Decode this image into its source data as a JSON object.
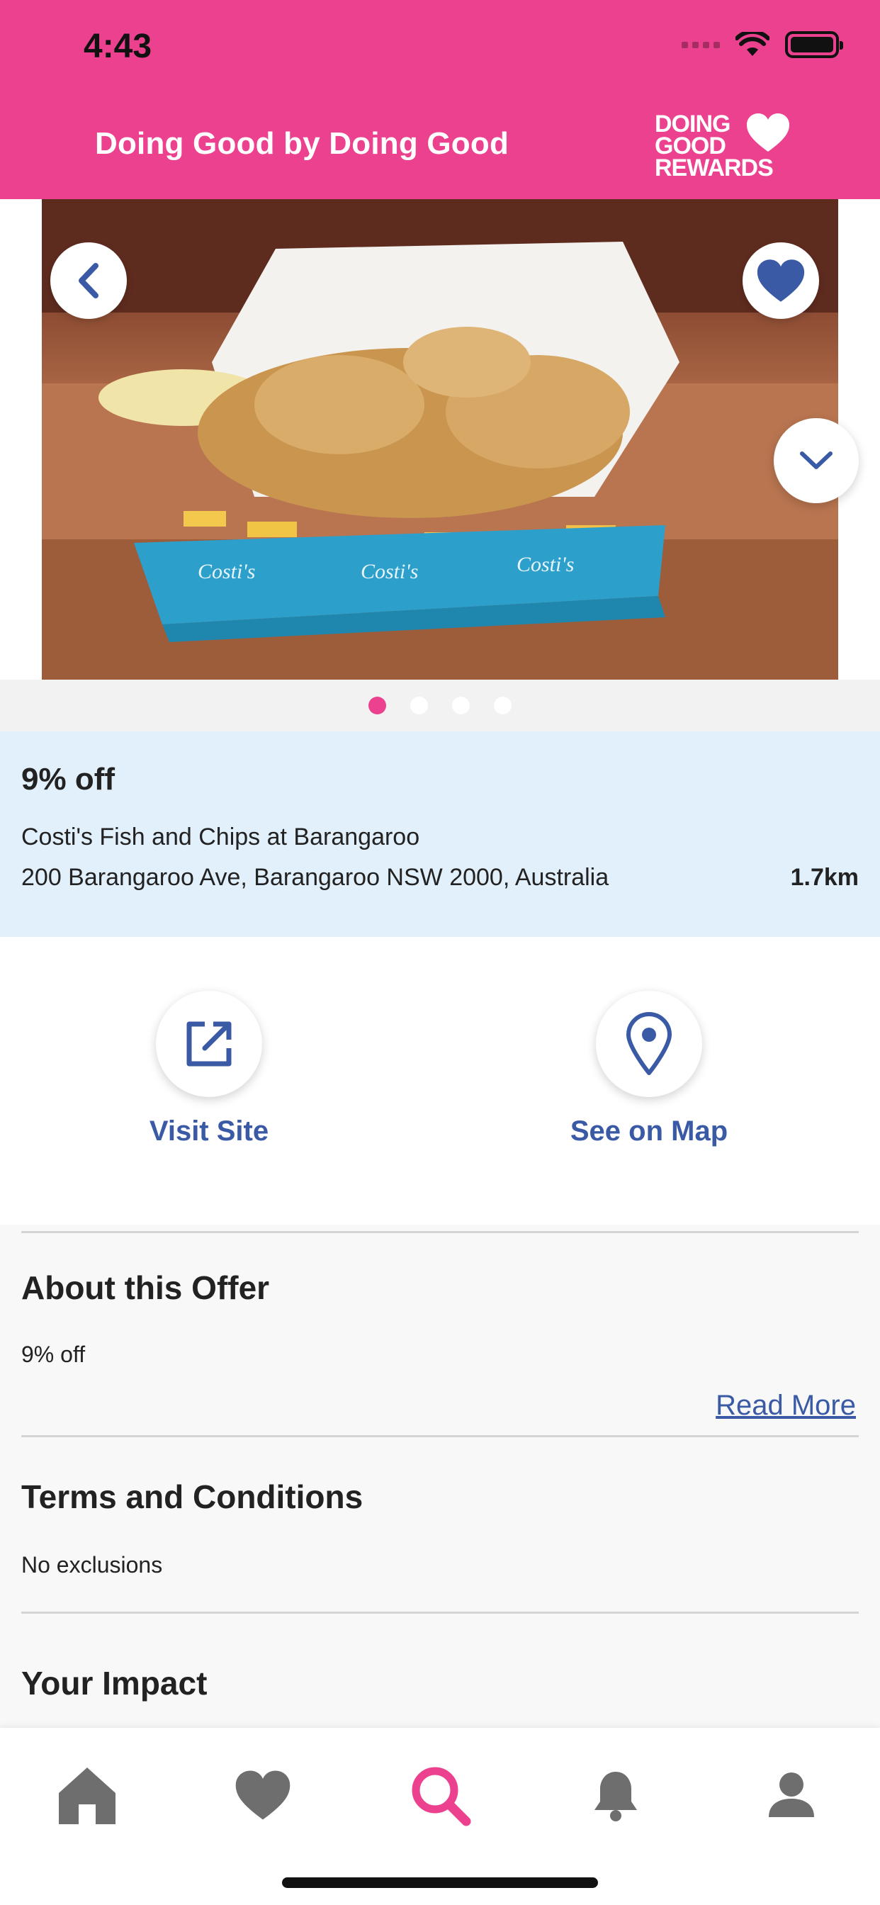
{
  "status_bar": {
    "time": "4:43"
  },
  "header": {
    "title": "Doing Good by Doing Good",
    "logo_lines": [
      "DOING",
      "GOOD",
      "REWARDS"
    ]
  },
  "hero": {
    "image": "fried calamari and chips in a branded paper box",
    "box_brand": "Costi's",
    "slides": 4,
    "active_slide": 1
  },
  "offer": {
    "title": "9% off",
    "merchant": "Costi's Fish and Chips at Barangaroo",
    "address": "200 Barangaroo Ave, Barangaroo NSW 2000, Australia",
    "distance": "1.7km"
  },
  "actions": {
    "visit_label": "Visit Site",
    "map_label": "See on Map"
  },
  "sections": {
    "about_title": "About this Offer",
    "about_body": "9% off",
    "read_more": "Read More",
    "terms_title": "Terms and Conditions",
    "terms_body": "No exclusions",
    "impact_title": "Your Impact"
  },
  "tabbar": {
    "items": [
      {
        "name": "home",
        "icon": "home-icon"
      },
      {
        "name": "favourites",
        "icon": "heart-icon"
      },
      {
        "name": "search",
        "icon": "search-icon",
        "active": true
      },
      {
        "name": "notifications",
        "icon": "bell-icon"
      },
      {
        "name": "profile",
        "icon": "person-icon"
      }
    ]
  },
  "colors": {
    "brand_pink": "#ec418f",
    "accent_blue": "#3a5aa6",
    "offer_bg": "#e2f0fb",
    "icon_grey": "#6e6e6e"
  }
}
